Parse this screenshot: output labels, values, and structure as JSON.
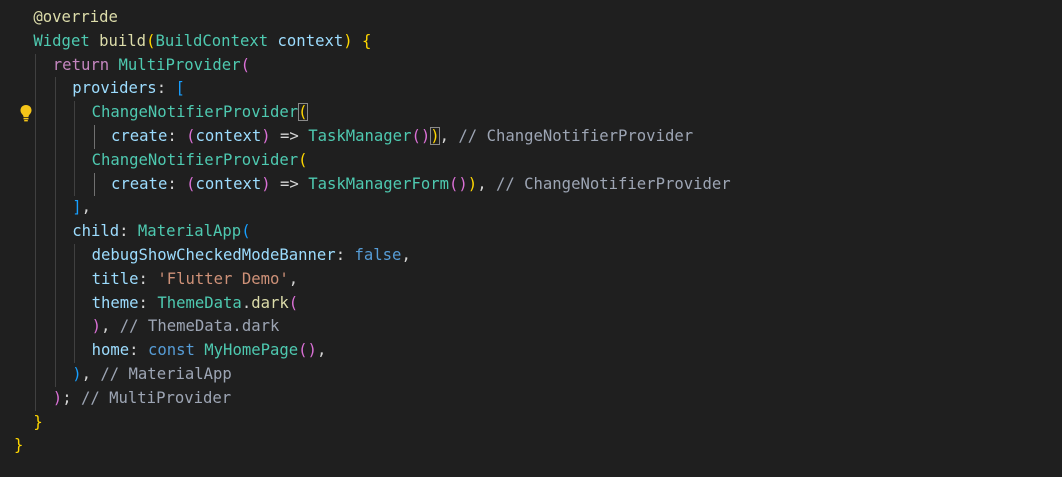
{
  "editor": {
    "theme_colors": {
      "background": "#1f1f1f",
      "keyword": "#569cd6",
      "control": "#c586c0",
      "type": "#4ec9b0",
      "function": "#dcdcaa",
      "variable": "#9cdcfe",
      "string": "#ce9178",
      "comment": "#9da5b4",
      "bracket_level_1": "#ffd700",
      "bracket_level_2": "#da70d6",
      "bracket_level_3": "#179fff"
    },
    "lightbulb_icon": "lightbulb-icon",
    "lines": [
      {
        "indent": 1,
        "tokens": [
          {
            "t": "@override",
            "c": "fn"
          }
        ]
      },
      {
        "indent": 1,
        "tokens": [
          {
            "t": "Widget",
            "c": "type"
          },
          {
            "t": " ",
            "c": "def"
          },
          {
            "t": "build",
            "c": "fn"
          },
          {
            "t": "(",
            "c": "b1"
          },
          {
            "t": "BuildContext",
            "c": "type"
          },
          {
            "t": " ",
            "c": "def"
          },
          {
            "t": "context",
            "c": "var"
          },
          {
            "t": ")",
            "c": "b1"
          },
          {
            "t": " ",
            "c": "def"
          },
          {
            "t": "{",
            "c": "b1"
          }
        ]
      },
      {
        "indent": 2,
        "tokens": [
          {
            "t": "return",
            "c": "ctl"
          },
          {
            "t": " ",
            "c": "def"
          },
          {
            "t": "MultiProvider",
            "c": "type"
          },
          {
            "t": "(",
            "c": "b2"
          }
        ]
      },
      {
        "indent": 3,
        "tokens": [
          {
            "t": "providers",
            "c": "var"
          },
          {
            "t": ": ",
            "c": "def"
          },
          {
            "t": "[",
            "c": "b3"
          }
        ]
      },
      {
        "indent": 4,
        "tokens": [
          {
            "t": "ChangeNotifierProvider",
            "c": "type"
          },
          {
            "t": "(",
            "c": "b1",
            "match": true
          }
        ]
      },
      {
        "indent": 5,
        "tokens": [
          {
            "t": "create",
            "c": "var"
          },
          {
            "t": ": ",
            "c": "def"
          },
          {
            "t": "(",
            "c": "b2"
          },
          {
            "t": "context",
            "c": "var"
          },
          {
            "t": ")",
            "c": "b2"
          },
          {
            "t": " => ",
            "c": "def"
          },
          {
            "t": "TaskManager",
            "c": "type"
          },
          {
            "t": "()",
            "c": "b2"
          },
          {
            "t": ")",
            "c": "b1",
            "match": true
          },
          {
            "t": ", ",
            "c": "def"
          },
          {
            "t": "// ChangeNotifierProvider",
            "c": "com"
          }
        ]
      },
      {
        "indent": 4,
        "tokens": [
          {
            "t": "ChangeNotifierProvider",
            "c": "type"
          },
          {
            "t": "(",
            "c": "b1"
          }
        ]
      },
      {
        "indent": 5,
        "tokens": [
          {
            "t": "create",
            "c": "var"
          },
          {
            "t": ": ",
            "c": "def"
          },
          {
            "t": "(",
            "c": "b2"
          },
          {
            "t": "context",
            "c": "var"
          },
          {
            "t": ")",
            "c": "b2"
          },
          {
            "t": " => ",
            "c": "def"
          },
          {
            "t": "TaskManagerForm",
            "c": "type"
          },
          {
            "t": "()",
            "c": "b2"
          },
          {
            "t": ")",
            "c": "b1"
          },
          {
            "t": ", ",
            "c": "def"
          },
          {
            "t": "// ChangeNotifierProvider",
            "c": "com"
          }
        ]
      },
      {
        "indent": 3,
        "tokens": [
          {
            "t": "]",
            "c": "b3"
          },
          {
            "t": ",",
            "c": "def"
          }
        ]
      },
      {
        "indent": 3,
        "tokens": [
          {
            "t": "child",
            "c": "var"
          },
          {
            "t": ": ",
            "c": "def"
          },
          {
            "t": "MaterialApp",
            "c": "type"
          },
          {
            "t": "(",
            "c": "b3"
          }
        ]
      },
      {
        "indent": 4,
        "tokens": [
          {
            "t": "debugShowCheckedModeBanner",
            "c": "var"
          },
          {
            "t": ": ",
            "c": "def"
          },
          {
            "t": "false",
            "c": "kw"
          },
          {
            "t": ",",
            "c": "def"
          }
        ]
      },
      {
        "indent": 4,
        "tokens": [
          {
            "t": "title",
            "c": "var"
          },
          {
            "t": ": ",
            "c": "def"
          },
          {
            "t": "'Flutter Demo'",
            "c": "str"
          },
          {
            "t": ",",
            "c": "def"
          }
        ]
      },
      {
        "indent": 4,
        "tokens": [
          {
            "t": "theme",
            "c": "var"
          },
          {
            "t": ": ",
            "c": "def"
          },
          {
            "t": "ThemeData",
            "c": "type"
          },
          {
            "t": ".",
            "c": "def"
          },
          {
            "t": "dark",
            "c": "fn"
          },
          {
            "t": "(",
            "c": "b2"
          }
        ]
      },
      {
        "indent": 4,
        "tokens": [
          {
            "t": ")",
            "c": "b2"
          },
          {
            "t": ", ",
            "c": "def"
          },
          {
            "t": "// ThemeData.dark",
            "c": "com"
          }
        ]
      },
      {
        "indent": 4,
        "tokens": [
          {
            "t": "home",
            "c": "var"
          },
          {
            "t": ": ",
            "c": "def"
          },
          {
            "t": "const",
            "c": "kw"
          },
          {
            "t": " ",
            "c": "def"
          },
          {
            "t": "MyHomePage",
            "c": "type"
          },
          {
            "t": "()",
            "c": "b2"
          },
          {
            "t": ",",
            "c": "def"
          }
        ]
      },
      {
        "indent": 3,
        "tokens": [
          {
            "t": ")",
            "c": "b3"
          },
          {
            "t": ", ",
            "c": "def"
          },
          {
            "t": "// MaterialApp",
            "c": "com"
          }
        ]
      },
      {
        "indent": 2,
        "tokens": [
          {
            "t": ")",
            "c": "b2"
          },
          {
            "t": "; ",
            "c": "def"
          },
          {
            "t": "// MultiProvider",
            "c": "com"
          }
        ]
      },
      {
        "indent": 1,
        "tokens": [
          {
            "t": "}",
            "c": "b1"
          }
        ]
      },
      {
        "indent": 0,
        "tokens": [
          {
            "t": "}",
            "c": "b1"
          }
        ]
      }
    ]
  }
}
